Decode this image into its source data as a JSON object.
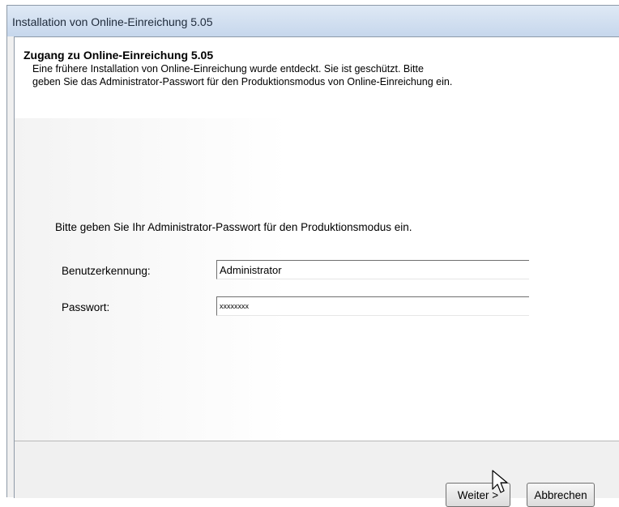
{
  "window": {
    "title": "Installation von Online-Einreichung 5.05"
  },
  "header": {
    "title": "Zugang zu Online-Einreichung 5.05",
    "description": "Eine frühere Installation von Online-Einreichung wurde entdeckt. Sie ist geschützt. Bitte geben Sie das Administrator-Passwort für den Produktionsmodus von Online-Einreichung ein."
  },
  "form": {
    "instruction": "Bitte geben Sie Ihr Administrator-Passwort für den Produktionsmodus ein.",
    "username_label": "Benutzerkennung:",
    "username_value": "Administrator",
    "password_label": "Passwort:",
    "password_value": "xxxxxxxx"
  },
  "buttons": {
    "next": "Weiter >",
    "cancel": "Abbrechen"
  }
}
